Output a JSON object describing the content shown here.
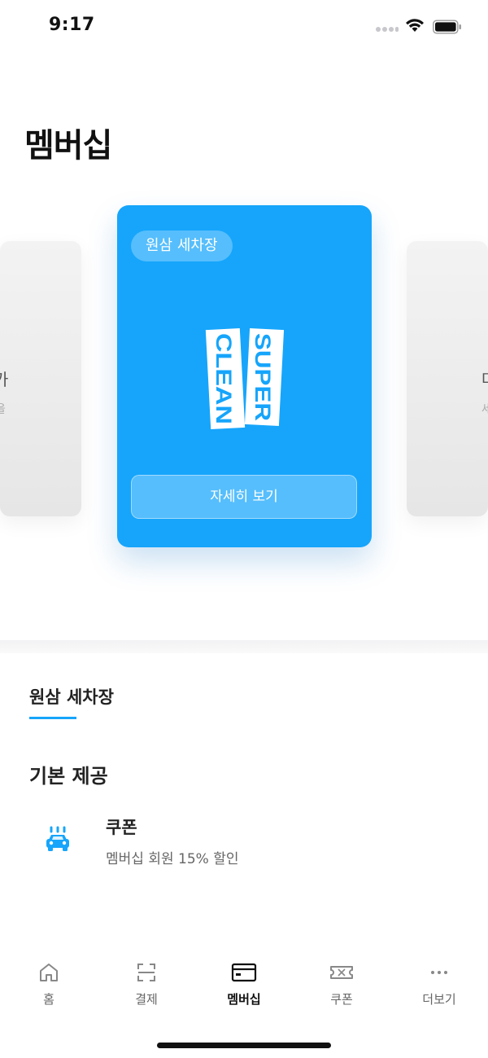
{
  "status_bar": {
    "time": "9:17"
  },
  "page": {
    "title": "멤버십"
  },
  "carousel": {
    "left_card": {
      "title": "카",
      "subtitle": "을"
    },
    "main_card": {
      "chip_label": "원삼 세차장",
      "logo_text": {
        "top": "SUPER",
        "bottom": "CLEAN"
      },
      "detail_button": "자세히 보기",
      "color": "#16a5fb"
    },
    "right_card": {
      "title": "마",
      "subtitle": "세"
    }
  },
  "tab": {
    "label": "원삼 세차장",
    "accent": "#16a5fb"
  },
  "section": {
    "heading": "기본 제공",
    "benefits": [
      {
        "icon": "car-wash-icon",
        "title": "쿠폰",
        "description": "멤버십 회원 15% 할인"
      }
    ]
  },
  "bottom_nav": {
    "items": [
      {
        "label": "홈",
        "icon": "home-icon"
      },
      {
        "label": "결제",
        "icon": "scan-icon"
      },
      {
        "label": "멤버십",
        "icon": "card-icon",
        "active": true
      },
      {
        "label": "쿠폰",
        "icon": "ticket-icon"
      },
      {
        "label": "더보기",
        "icon": "more-icon"
      }
    ]
  }
}
